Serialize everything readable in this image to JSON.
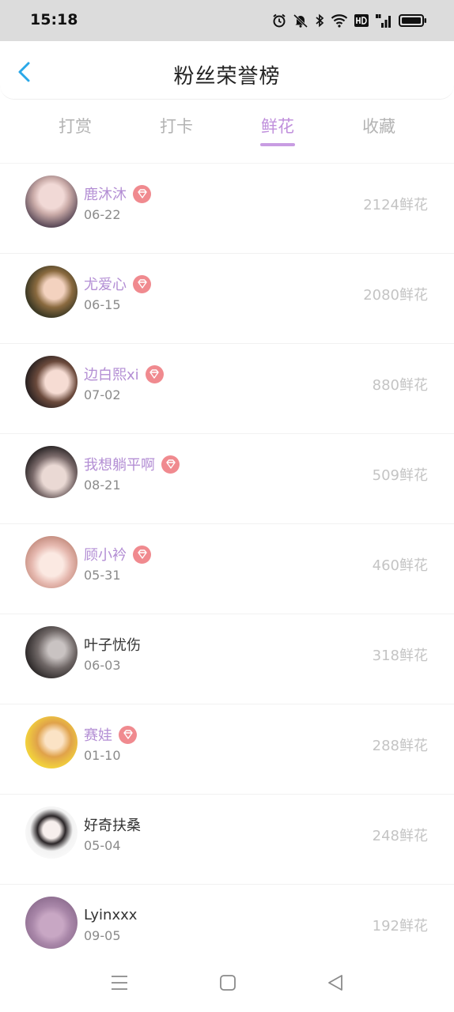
{
  "status": {
    "time": "15:18"
  },
  "header": {
    "title": "粉丝荣誉榜"
  },
  "tabs": [
    {
      "label": "打赏"
    },
    {
      "label": "打卡"
    },
    {
      "label": "鲜花"
    },
    {
      "label": "收藏"
    }
  ],
  "active_tab": "鲜花",
  "list": [
    {
      "name": "鹿沐沐",
      "date": "06-22",
      "count": "2124鲜花",
      "vip": true
    },
    {
      "name": "尤爱心",
      "date": "06-15",
      "count": "2080鲜花",
      "vip": true
    },
    {
      "name": "边白熙xi",
      "date": "07-02",
      "count": "880鲜花",
      "vip": true
    },
    {
      "name": "我想躺平啊",
      "date": "08-21",
      "count": "509鲜花",
      "vip": true
    },
    {
      "name": "顾小衿",
      "date": "05-31",
      "count": "460鲜花",
      "vip": true
    },
    {
      "name": "叶子忧伤",
      "date": "06-03",
      "count": "318鲜花",
      "vip": false
    },
    {
      "name": "赛娃",
      "date": "01-10",
      "count": "288鲜花",
      "vip": true
    },
    {
      "name": "好奇扶桑",
      "date": "05-04",
      "count": "248鲜花",
      "vip": false
    },
    {
      "name": "Lyinxxx",
      "date": "09-05",
      "count": "192鲜花",
      "vip": false
    }
  ],
  "colors": {
    "accent": "#c090dc",
    "vip_name": "#b38ed4",
    "badge": "#f08a8f",
    "back_arrow": "#2aa8e8"
  }
}
